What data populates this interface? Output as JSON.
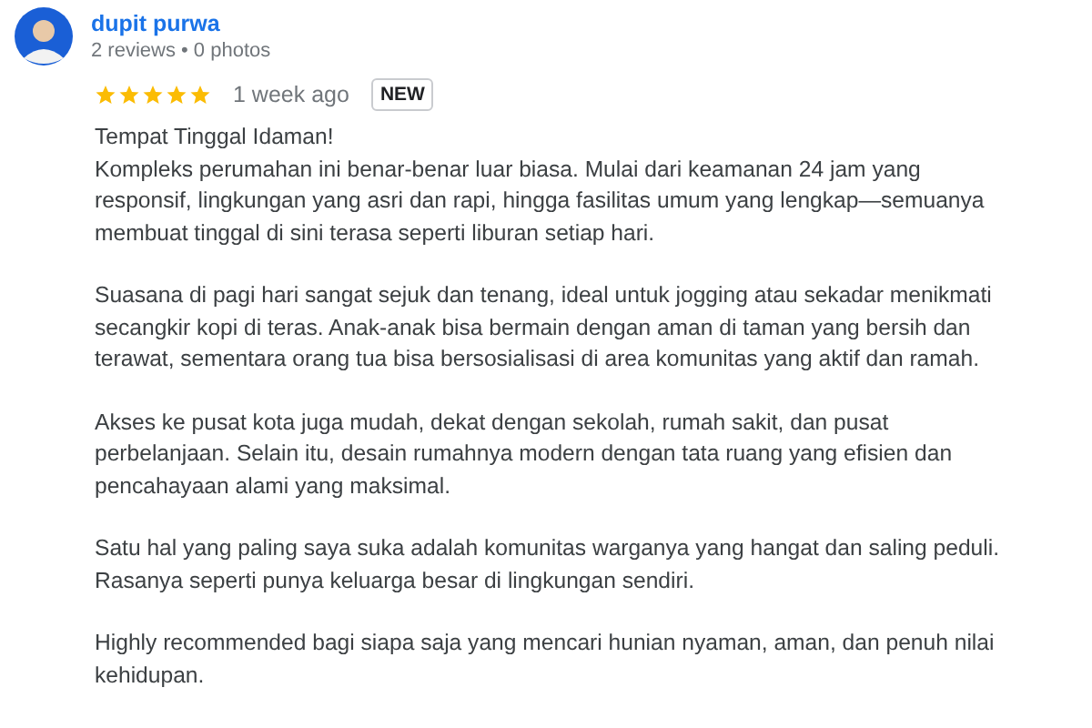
{
  "reviewer": {
    "name": "dupit purwa",
    "meta": "2 reviews • 0 photos"
  },
  "review": {
    "stars": 5,
    "time": "1 week ago",
    "badge": "NEW",
    "title": "Tempat Tinggal Idaman!",
    "paragraphs": [
      "Kompleks perumahan ini benar-benar luar biasa. Mulai dari keamanan 24 jam yang responsif, lingkungan yang asri dan rapi, hingga fasilitas umum yang lengkap—semuanya membuat tinggal di sini terasa seperti liburan setiap hari.",
      "Suasana di pagi hari sangat sejuk dan tenang, ideal untuk jogging atau sekadar menikmati secangkir kopi di teras. Anak-anak bisa bermain dengan aman di taman yang bersih dan terawat, sementara orang tua bisa bersosialisasi di area komunitas yang aktif dan ramah.",
      "Akses ke pusat kota juga mudah, dekat dengan sekolah, rumah sakit, dan pusat perbelanjaan. Selain itu, desain rumahnya modern dengan tata ruang yang efisien dan pencahayaan alami yang maksimal.",
      "Satu hal yang paling saya suka adalah komunitas warganya yang hangat dan saling peduli. Rasanya seperti punya keluarga besar di lingkungan sendiri.",
      "Highly recommended bagi siapa saja yang mencari hunian nyaman, aman, dan penuh nilai kehidupan."
    ]
  }
}
